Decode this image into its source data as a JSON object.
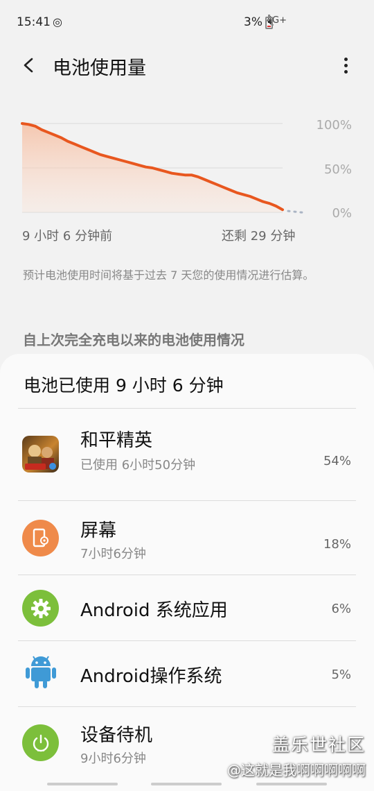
{
  "status": {
    "time": "15:41",
    "sync_icon": "sync-icon",
    "network": "4G+",
    "battery": "3%"
  },
  "header": {
    "title": "电池使用量"
  },
  "chart_data": {
    "type": "area",
    "x_start_label": "9 小时 6 分钟前",
    "x_end_label": "还剩 29 分钟",
    "y_ticks": [
      "100%",
      "50%",
      "0%"
    ],
    "ylim": [
      0,
      100
    ],
    "series": [
      {
        "values": [
          100,
          99,
          97,
          93,
          90,
          87,
          84,
          80,
          77,
          74,
          71,
          68,
          65,
          63,
          61,
          59,
          57,
          55,
          53,
          51,
          50,
          48,
          46,
          44,
          43,
          42,
          42,
          40,
          37,
          34,
          31,
          28,
          25,
          22,
          20,
          18,
          15,
          12,
          10,
          7,
          3
        ],
        "color": "#e8571f"
      }
    ],
    "grid": true
  },
  "note": "预计电池使用时间将基于过去 7 天您的使用情况进行估算。",
  "section_title": "自上次完全充电以来的电池使用情况",
  "usage": {
    "title": "电池已使用 9 小时 6 分钟",
    "apps": [
      {
        "name": "和平精英",
        "sub": "已使用 6小时50分钟",
        "pct": "54%",
        "icon": "game-icon"
      },
      {
        "name": "屏幕",
        "sub": "7小时6分钟",
        "pct": "18%",
        "icon": "screen-icon",
        "color": "#ef8a4a"
      },
      {
        "name": "Android 系统应用",
        "sub": "",
        "pct": "6%",
        "icon": "gear-icon",
        "color": "#7cbf3b"
      },
      {
        "name": "Android操作系统",
        "sub": "",
        "pct": "5%",
        "icon": "android-icon",
        "color": "#3f9ad6"
      },
      {
        "name": "设备待机",
        "sub": "9小时6分钟",
        "pct": "",
        "icon": "power-icon",
        "color": "#7cbf3b"
      }
    ]
  },
  "watermark": {
    "line1": "盖乐世社区",
    "line2": "@这就是我啊啊啊啊啊"
  }
}
